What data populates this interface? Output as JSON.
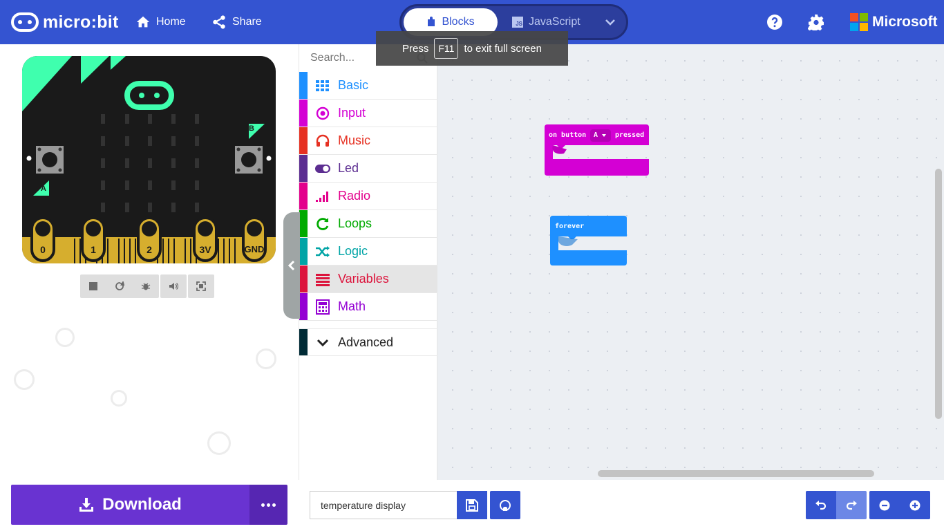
{
  "header": {
    "brand": "micro:bit",
    "home_label": "Home",
    "share_label": "Share",
    "blocks_label": "Blocks",
    "javascript_label": "JavaScript",
    "js_badge": "JS",
    "microsoft_label": "Microsoft",
    "colors": {
      "bar": "#3454D1",
      "toggle": "#2C3E9D"
    }
  },
  "fullscreen_tip": {
    "press": "Press",
    "key": "F11",
    "suffix": "to exit full screen"
  },
  "simulator": {
    "pins": [
      "0",
      "1",
      "2",
      "3V",
      "GND"
    ],
    "button_a": "A",
    "button_b": "B",
    "controls": [
      "stop-icon",
      "restart-icon",
      "debug-icon",
      "sound-icon",
      "fullscreen-icon"
    ]
  },
  "toolbox": {
    "search_placeholder": "Search...",
    "categories": [
      {
        "label": "Basic",
        "color": "#1E90FF",
        "icon": "grid-icon"
      },
      {
        "label": "Input",
        "color": "#D400D4",
        "icon": "target-icon"
      },
      {
        "label": "Music",
        "color": "#E63022",
        "icon": "headphones-icon"
      },
      {
        "label": "Led",
        "color": "#5C2D91",
        "icon": "toggle-icon"
      },
      {
        "label": "Radio",
        "color": "#E3008C",
        "icon": "signal-bars-icon"
      },
      {
        "label": "Loops",
        "color": "#00AA00",
        "icon": "refresh-icon"
      },
      {
        "label": "Logic",
        "color": "#00A4A6",
        "icon": "shuffle-icon"
      },
      {
        "label": "Variables",
        "color": "#DC143C",
        "icon": "list-lines-icon"
      },
      {
        "label": "Math",
        "color": "#9400D3",
        "icon": "calculator-icon"
      }
    ],
    "advanced_label": "Advanced",
    "selected": "Variables"
  },
  "workspace": {
    "block_button": {
      "prefix": "on button",
      "value": "A",
      "suffix": "pressed",
      "color": "#D400D4"
    },
    "block_forever": {
      "label": "forever",
      "color": "#1E90FF"
    }
  },
  "bottom": {
    "download_label": "Download",
    "project_name": "temperature display"
  }
}
